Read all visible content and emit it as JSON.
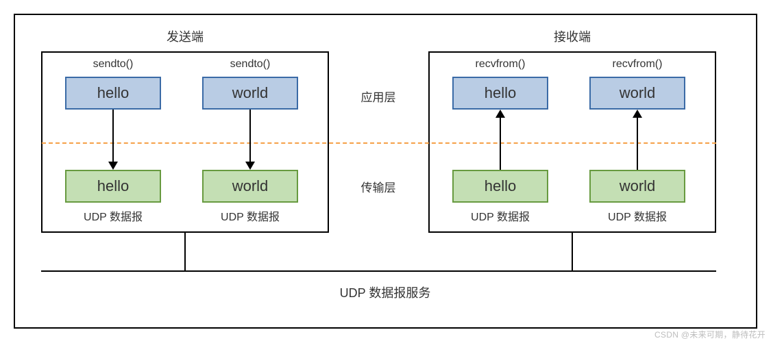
{
  "sender_title": "发送端",
  "receiver_title": "接收端",
  "sender_func": "sendto()",
  "receiver_func": "recvfrom()",
  "msg1": "hello",
  "msg2": "world",
  "app_layer": "应用层",
  "trans_layer": "传输层",
  "dgram_label": "UDP 数据报",
  "service_label": "UDP 数据报服务",
  "watermark": "CSDN @未来可期，静待花开"
}
